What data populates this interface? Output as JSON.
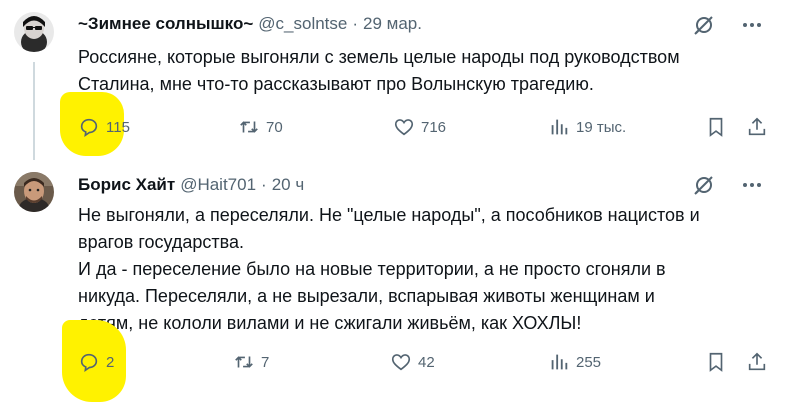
{
  "tweets": [
    {
      "author_name": "~Зимнее солнышко~",
      "handle": "@c_solntse",
      "separator": "·",
      "time": "29 мар.",
      "text_lines": [
        "Россияне, которые выгоняли с земель целые народы под руководством",
        "Сталина, мне что-то рассказывают про Волынскую трагедию."
      ],
      "stats": {
        "replies": "115",
        "reposts": "70",
        "likes": "716",
        "views": "19 тыс."
      }
    },
    {
      "author_name": "Борис Хайт",
      "handle": "@Hait701",
      "separator": "·",
      "time": "20 ч",
      "text_lines": [
        "Не выгоняли, а переселяли. Не \"целые народы\", а пособников нацистов и",
        "врагов государства.",
        "И да - переселение было на новые территории, а не просто сгоняли в",
        "никуда. Переселяли, а не вырезали, вспарывая животы женщинам и",
        "детям, не кололи вилами и не сжигали живьём, как ХОХЛЫ!"
      ],
      "stats": {
        "replies": "2",
        "reposts": "7",
        "likes": "42",
        "views": "255"
      }
    }
  ],
  "colors": {
    "text": "#0f1419",
    "muted": "#536471",
    "highlight": "#fff200",
    "thread_line": "#cfd9de"
  },
  "icons": [
    "grok-icon",
    "more-icon",
    "reply-icon",
    "repost-icon",
    "like-icon",
    "views-icon",
    "bookmark-icon",
    "share-icon"
  ]
}
